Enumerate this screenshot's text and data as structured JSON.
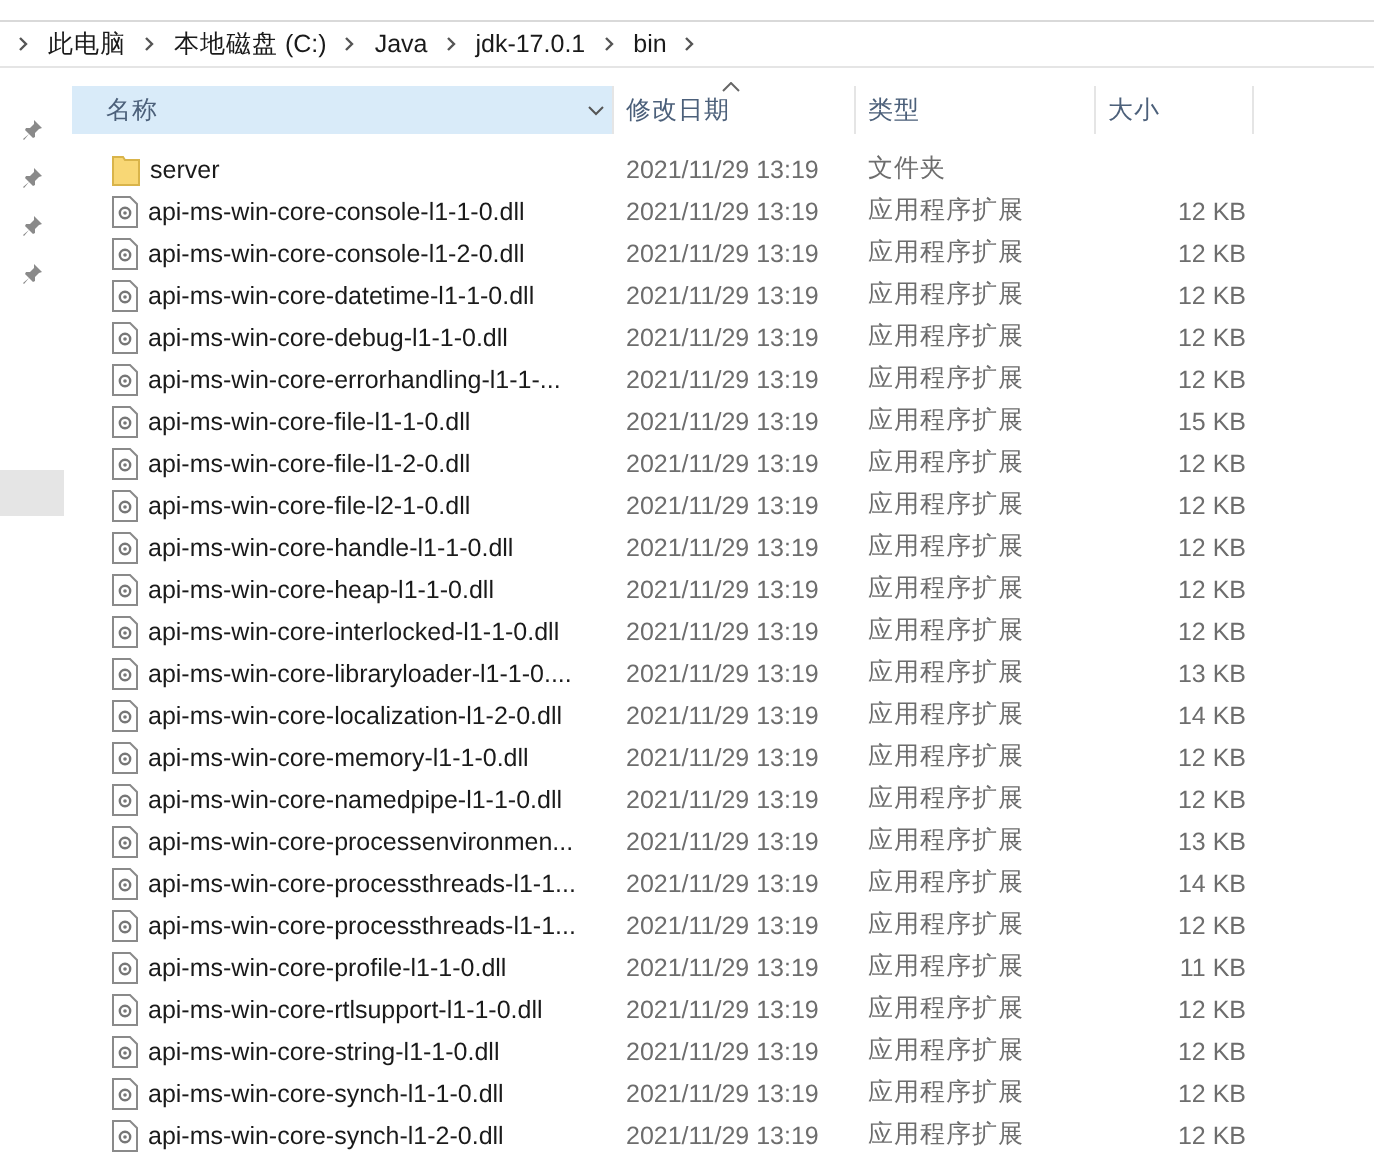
{
  "breadcrumb": [
    "此电脑",
    "本地磁盘 (C:)",
    "Java",
    "jdk-17.0.1",
    "bin"
  ],
  "columns": [
    {
      "label": "名称",
      "hovered": true,
      "sorted": false
    },
    {
      "label": "修改日期",
      "hovered": false,
      "sorted": true
    },
    {
      "label": "类型",
      "hovered": false,
      "sorted": false
    },
    {
      "label": "大小",
      "hovered": false,
      "sorted": false
    }
  ],
  "rows": [
    {
      "kind": "folder",
      "name": "server",
      "date": "2021/11/29 13:19",
      "type": "文件夹"
    },
    {
      "kind": "file",
      "name": "api-ms-win-core-console-l1-1-0.dll",
      "date": "2021/11/29 13:19",
      "type": "应用程序扩展",
      "size": "12 KB"
    },
    {
      "kind": "file",
      "name": "api-ms-win-core-console-l1-2-0.dll",
      "date": "2021/11/29 13:19",
      "type": "应用程序扩展",
      "size": "12 KB"
    },
    {
      "kind": "file",
      "name": "api-ms-win-core-datetime-l1-1-0.dll",
      "date": "2021/11/29 13:19",
      "type": "应用程序扩展",
      "size": "12 KB"
    },
    {
      "kind": "file",
      "name": "api-ms-win-core-debug-l1-1-0.dll",
      "date": "2021/11/29 13:19",
      "type": "应用程序扩展",
      "size": "12 KB"
    },
    {
      "kind": "file",
      "name": "api-ms-win-core-errorhandling-l1-1-...",
      "date": "2021/11/29 13:19",
      "type": "应用程序扩展",
      "size": "12 KB"
    },
    {
      "kind": "file",
      "name": "api-ms-win-core-file-l1-1-0.dll",
      "date": "2021/11/29 13:19",
      "type": "应用程序扩展",
      "size": "15 KB"
    },
    {
      "kind": "file",
      "name": "api-ms-win-core-file-l1-2-0.dll",
      "date": "2021/11/29 13:19",
      "type": "应用程序扩展",
      "size": "12 KB"
    },
    {
      "kind": "file",
      "name": "api-ms-win-core-file-l2-1-0.dll",
      "date": "2021/11/29 13:19",
      "type": "应用程序扩展",
      "size": "12 KB"
    },
    {
      "kind": "file",
      "name": "api-ms-win-core-handle-l1-1-0.dll",
      "date": "2021/11/29 13:19",
      "type": "应用程序扩展",
      "size": "12 KB"
    },
    {
      "kind": "file",
      "name": "api-ms-win-core-heap-l1-1-0.dll",
      "date": "2021/11/29 13:19",
      "type": "应用程序扩展",
      "size": "12 KB"
    },
    {
      "kind": "file",
      "name": "api-ms-win-core-interlocked-l1-1-0.dll",
      "date": "2021/11/29 13:19",
      "type": "应用程序扩展",
      "size": "12 KB"
    },
    {
      "kind": "file",
      "name": "api-ms-win-core-libraryloader-l1-1-0....",
      "date": "2021/11/29 13:19",
      "type": "应用程序扩展",
      "size": "13 KB"
    },
    {
      "kind": "file",
      "name": "api-ms-win-core-localization-l1-2-0.dll",
      "date": "2021/11/29 13:19",
      "type": "应用程序扩展",
      "size": "14 KB"
    },
    {
      "kind": "file",
      "name": "api-ms-win-core-memory-l1-1-0.dll",
      "date": "2021/11/29 13:19",
      "type": "应用程序扩展",
      "size": "12 KB"
    },
    {
      "kind": "file",
      "name": "api-ms-win-core-namedpipe-l1-1-0.dll",
      "date": "2021/11/29 13:19",
      "type": "应用程序扩展",
      "size": "12 KB"
    },
    {
      "kind": "file",
      "name": "api-ms-win-core-processenvironmen...",
      "date": "2021/11/29 13:19",
      "type": "应用程序扩展",
      "size": "13 KB"
    },
    {
      "kind": "file",
      "name": "api-ms-win-core-processthreads-l1-1...",
      "date": "2021/11/29 13:19",
      "type": "应用程序扩展",
      "size": "14 KB"
    },
    {
      "kind": "file",
      "name": "api-ms-win-core-processthreads-l1-1...",
      "date": "2021/11/29 13:19",
      "type": "应用程序扩展",
      "size": "12 KB"
    },
    {
      "kind": "file",
      "name": "api-ms-win-core-profile-l1-1-0.dll",
      "date": "2021/11/29 13:19",
      "type": "应用程序扩展",
      "size": "11 KB"
    },
    {
      "kind": "file",
      "name": "api-ms-win-core-rtlsupport-l1-1-0.dll",
      "date": "2021/11/29 13:19",
      "type": "应用程序扩展",
      "size": "12 KB"
    },
    {
      "kind": "file",
      "name": "api-ms-win-core-string-l1-1-0.dll",
      "date": "2021/11/29 13:19",
      "type": "应用程序扩展",
      "size": "12 KB"
    },
    {
      "kind": "file",
      "name": "api-ms-win-core-synch-l1-1-0.dll",
      "date": "2021/11/29 13:19",
      "type": "应用程序扩展",
      "size": "12 KB"
    },
    {
      "kind": "file",
      "name": "api-ms-win-core-synch-l1-2-0.dll",
      "date": "2021/11/29 13:19",
      "type": "应用程序扩展",
      "size": "12 KB"
    }
  ]
}
